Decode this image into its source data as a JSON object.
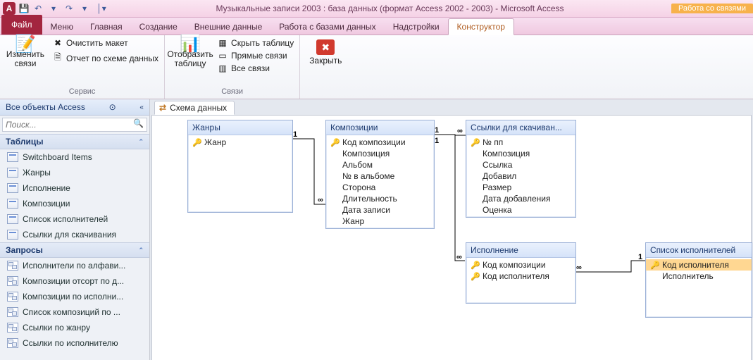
{
  "titlebar": {
    "app_letter": "A",
    "title": "Музыкальные записи 2003 : база данных (формат Access 2002 - 2003)  -  Microsoft Access",
    "context_group": "Работа со связями"
  },
  "tabs": {
    "file": "Файл",
    "items": [
      "Меню",
      "Главная",
      "Создание",
      "Внешние данные",
      "Работа с базами данных",
      "Надстройки"
    ],
    "context": "Конструктор"
  },
  "ribbon": {
    "service": {
      "edit": "Изменить связи",
      "clear": "Очистить макет",
      "report": "Отчет по схеме данных",
      "label": "Сервис"
    },
    "show": {
      "table": "Отобразить таблицу",
      "label": ""
    },
    "links": {
      "hide": "Скрыть таблицу",
      "direct": "Прямые связи",
      "all": "Все связи",
      "label": "Связи"
    },
    "close": {
      "btn": "Закрыть"
    }
  },
  "nav": {
    "header": "Все объекты Access",
    "search_ph": "Поиск...",
    "cat_tables": "Таблицы",
    "cat_queries": "Запросы",
    "tables": [
      "Switchboard Items",
      "Жанры",
      "Исполнение",
      "Композиции",
      "Список исполнителей",
      "Ссылки для скачивания"
    ],
    "queries": [
      "Исполнители по алфави...",
      "Композиции отсорт по д...",
      "Композиции по исполни...",
      "Список композиций  по ...",
      "Ссылки по жанру",
      "Ссылки по исполнителю"
    ]
  },
  "doc_tab": "Схема данных",
  "diagram": {
    "genres": {
      "title": "Жанры",
      "fields": [
        {
          "k": true,
          "n": "Жанр"
        }
      ]
    },
    "comp": {
      "title": "Композиции",
      "fields": [
        {
          "k": true,
          "n": "Код композиции"
        },
        {
          "k": false,
          "n": "Композиция"
        },
        {
          "k": false,
          "n": "Альбом"
        },
        {
          "k": false,
          "n": "№ в альбоме"
        },
        {
          "k": false,
          "n": "Сторона"
        },
        {
          "k": false,
          "n": "Длительность"
        },
        {
          "k": false,
          "n": "Дата записи"
        },
        {
          "k": false,
          "n": "Жанр"
        }
      ]
    },
    "links": {
      "title": "Ссылки для скачиван...",
      "fields": [
        {
          "k": true,
          "n": "№ пп"
        },
        {
          "k": false,
          "n": "Композиция"
        },
        {
          "k": false,
          "n": "Ссылка"
        },
        {
          "k": false,
          "n": "Добавил"
        },
        {
          "k": false,
          "n": "Размер"
        },
        {
          "k": false,
          "n": "Дата добавления"
        },
        {
          "k": false,
          "n": "Оценка"
        }
      ]
    },
    "perf": {
      "title": "Исполнение",
      "fields": [
        {
          "k": true,
          "n": "Код композиции"
        },
        {
          "k": true,
          "n": "Код исполнителя"
        }
      ]
    },
    "artists": {
      "title": "Список исполнителей",
      "fields": [
        {
          "k": true,
          "n": "Код исполнителя",
          "sel": true
        },
        {
          "k": false,
          "n": "Исполнитель"
        }
      ]
    }
  },
  "rel_labels": {
    "one": "1",
    "many": "∞"
  }
}
